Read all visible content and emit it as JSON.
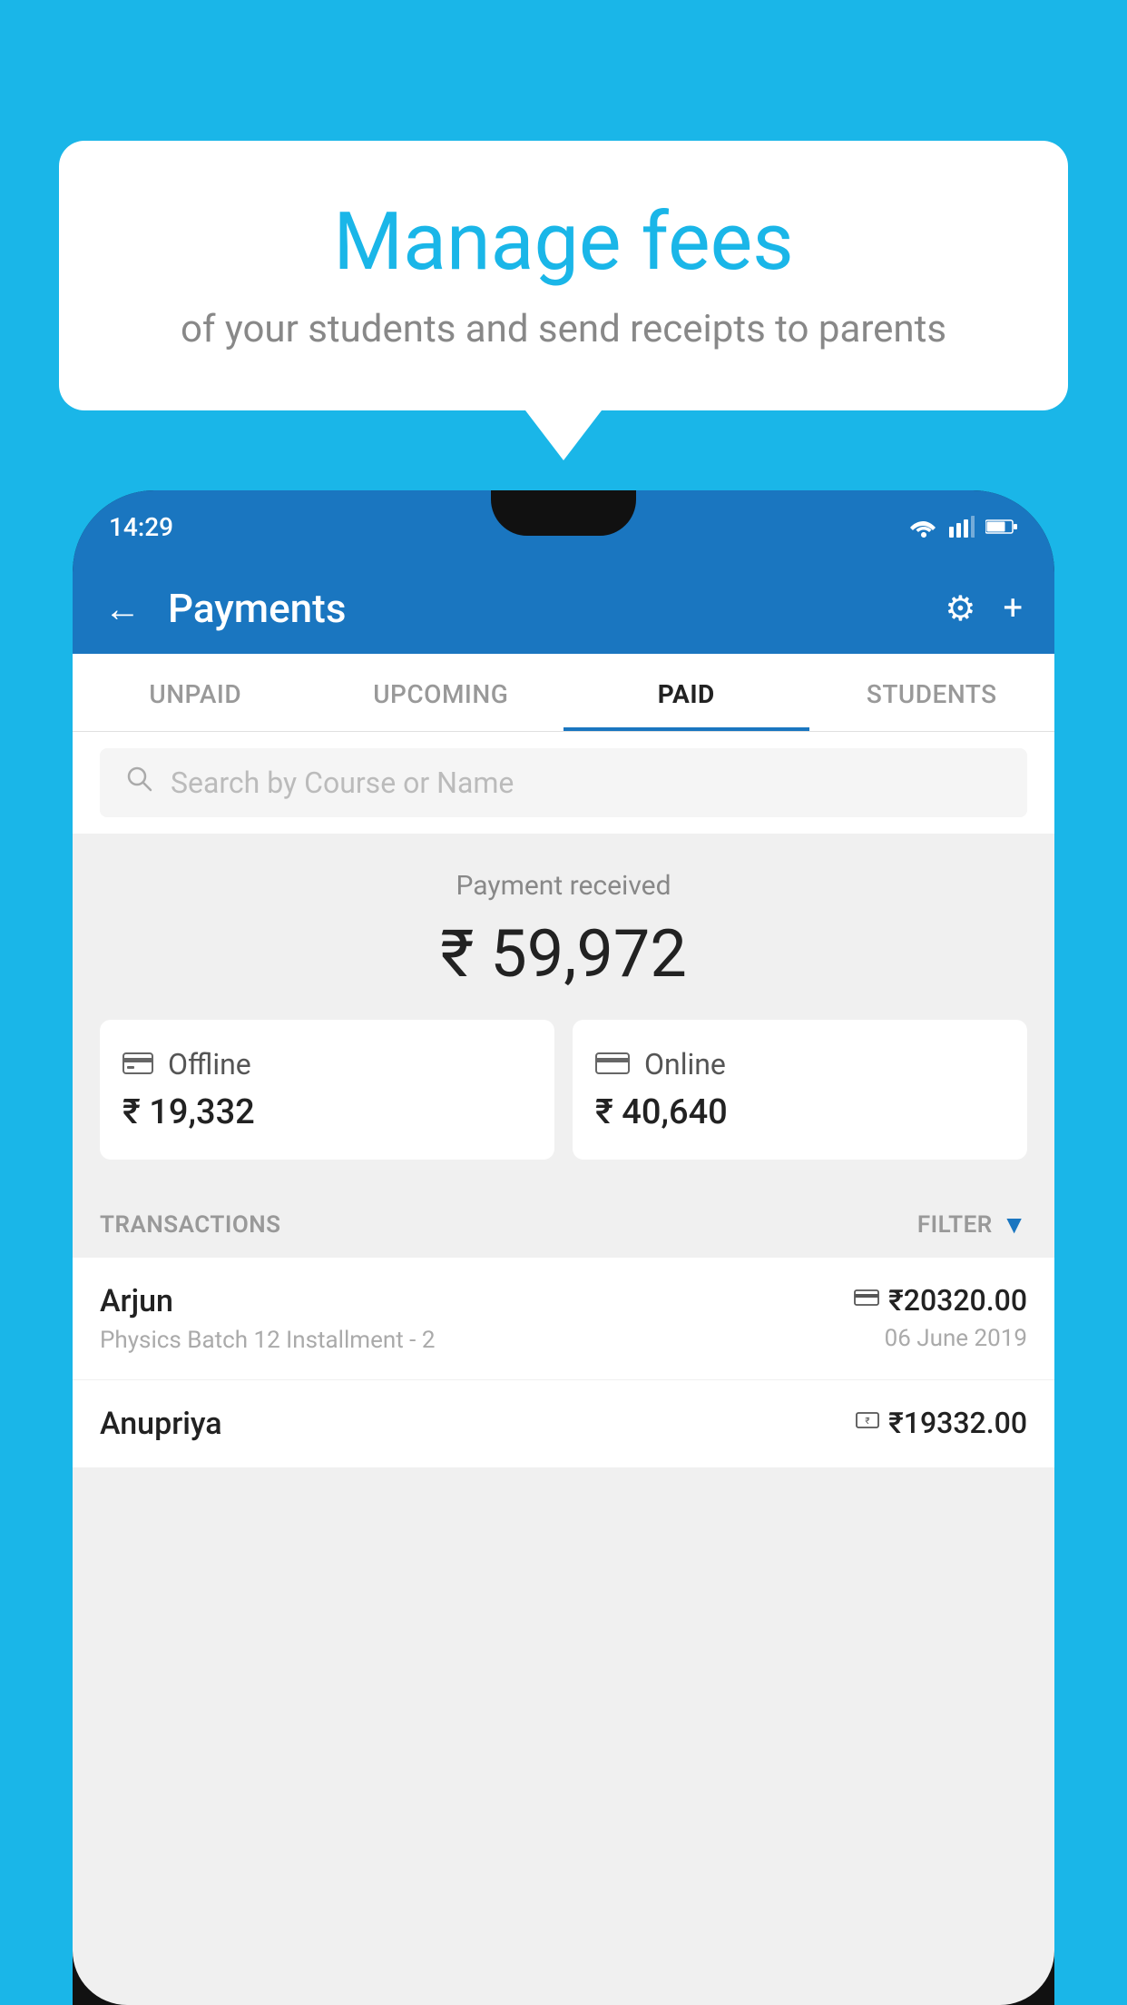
{
  "background_color": "#1ab6e8",
  "speech_bubble": {
    "title": "Manage fees",
    "subtitle": "of your students and send receipts to parents"
  },
  "status_bar": {
    "time": "14:29"
  },
  "app_header": {
    "title": "Payments",
    "back_label": "←",
    "settings_label": "⚙",
    "add_label": "+"
  },
  "tabs": [
    {
      "label": "UNPAID",
      "active": false
    },
    {
      "label": "UPCOMING",
      "active": false
    },
    {
      "label": "PAID",
      "active": true
    },
    {
      "label": "STUDENTS",
      "active": false
    }
  ],
  "search": {
    "placeholder": "Search by Course or Name"
  },
  "payment_summary": {
    "label": "Payment received",
    "total": "₹ 59,972",
    "offline": {
      "type": "Offline",
      "amount": "₹ 19,332"
    },
    "online": {
      "type": "Online",
      "amount": "₹ 40,640"
    }
  },
  "transactions": {
    "label": "TRANSACTIONS",
    "filter_label": "FILTER",
    "items": [
      {
        "name": "Arjun",
        "detail": "Physics Batch 12 Installment - 2",
        "amount": "₹20320.00",
        "date": "06 June 2019",
        "method": "card"
      },
      {
        "name": "Anupriya",
        "detail": "",
        "amount": "₹19332.00",
        "date": "",
        "method": "cash"
      }
    ]
  }
}
